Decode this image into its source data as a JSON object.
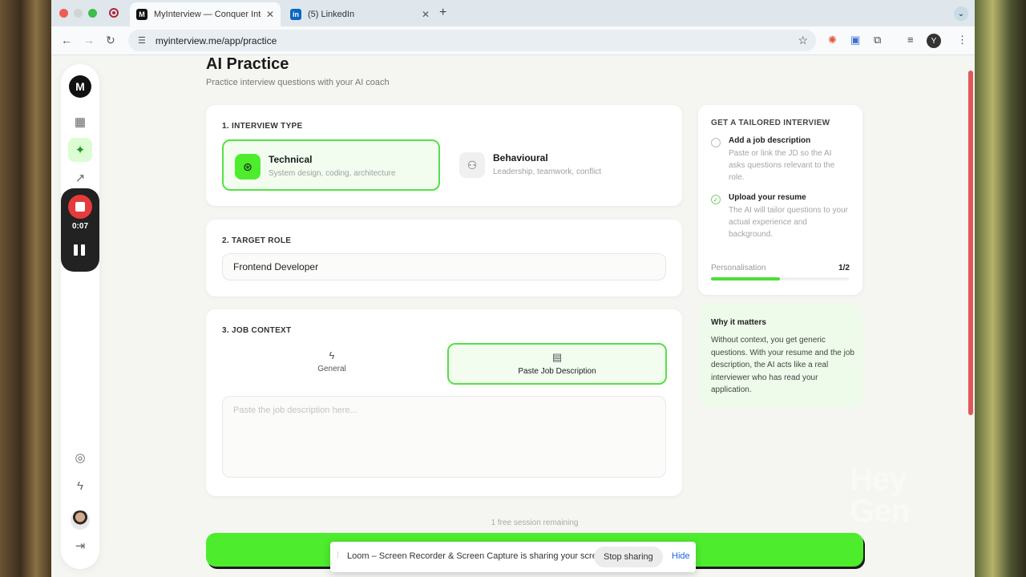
{
  "browser": {
    "tabs": [
      {
        "title": "MyInterview — Conquer Inter",
        "favicon": "M"
      },
      {
        "title": "(5) LinkedIn",
        "favicon": "in"
      }
    ],
    "url": "myinterview.me/app/practice",
    "profile_initial": "Y"
  },
  "sidebar": {
    "logo": "M",
    "recording_time": "0:07"
  },
  "main": {
    "title": "AI Practice",
    "subtitle": "Practice interview questions with your AI coach",
    "interview_type": {
      "label": "1. INTERVIEW TYPE",
      "options": [
        {
          "title": "Technical",
          "desc": "System design, coding, architecture",
          "selected": true
        },
        {
          "title": "Behavioural",
          "desc": "Leadership, teamwork, conflict",
          "selected": false
        }
      ]
    },
    "target_role": {
      "label": "2. TARGET ROLE",
      "value": "Frontend Developer"
    },
    "job_context": {
      "label": "3. JOB CONTEXT",
      "tabs": [
        {
          "label": "General",
          "selected": false
        },
        {
          "label": "Paste Job Description",
          "selected": true
        }
      ],
      "placeholder": "Paste the job description here..."
    },
    "free_sessions": "1 free session remaining"
  },
  "tailored": {
    "title": "GET A TAILORED INTERVIEW",
    "steps": [
      {
        "title": "Add a job description",
        "desc": "Paste or link the JD so the AI asks questions relevant to the role.",
        "done": false
      },
      {
        "title": "Upload your resume",
        "desc": "The AI will tailor questions to your actual experience and background.",
        "done": true
      }
    ],
    "personalisation_label": "Personalisation",
    "personalisation_count": "1/2",
    "personalisation_fraction": 0.5
  },
  "why": {
    "title": "Why it matters",
    "text": "Without context, you get generic questions. With your resume and the job description, the AI acts like a real interviewer who has read your application."
  },
  "loom": {
    "message": "Loom – Screen Recorder & Screen Capture is sharing your screen.",
    "stop_label": "Stop sharing",
    "hide_label": "Hide"
  },
  "watermark": {
    "line1": "Hey",
    "line2": "Gen"
  },
  "colors": {
    "accent": "#4ded2e",
    "selected_border": "#56e047",
    "recorder_red": "#e63b3b"
  }
}
